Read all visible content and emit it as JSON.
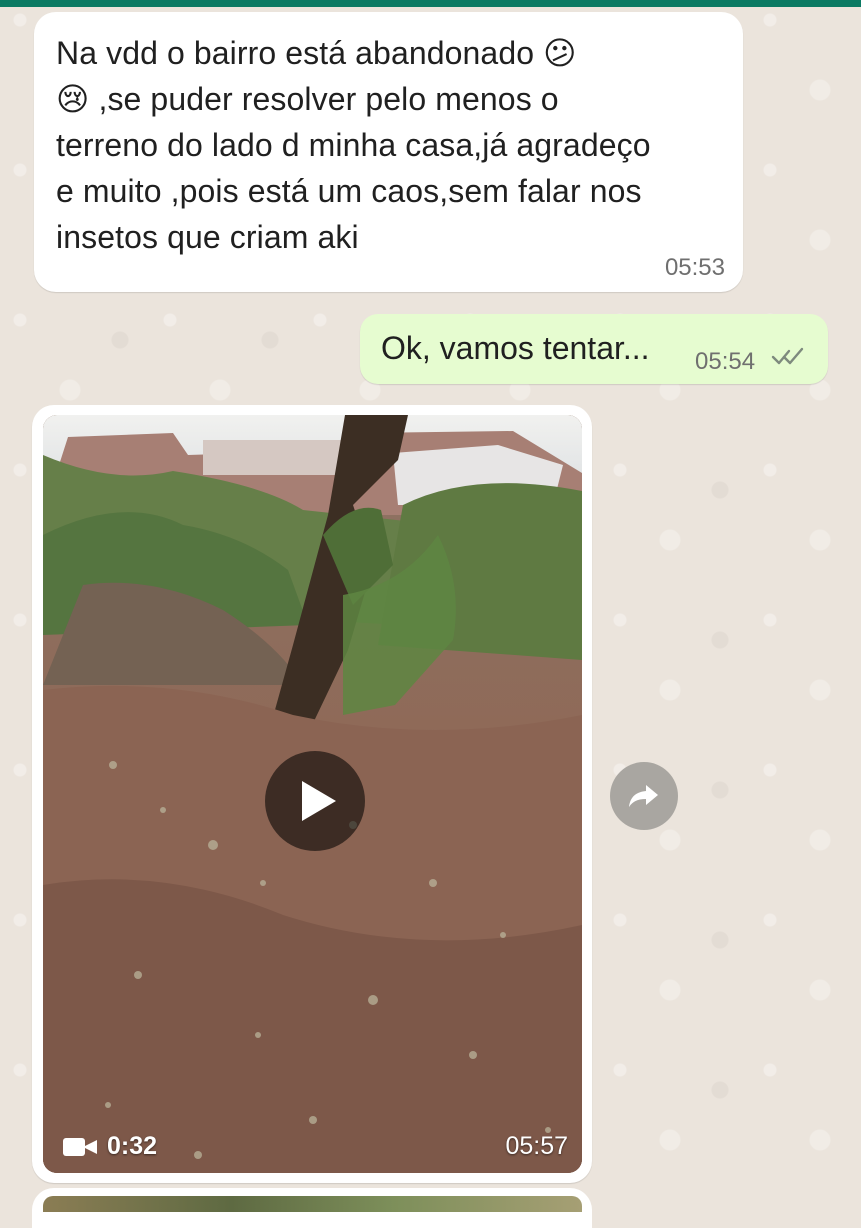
{
  "messages": [
    {
      "type": "text",
      "direction": "incoming",
      "text": "Na vdd o bairro está abandonado 😕\n😢 ,se puder resolver pelo menos o\nterreno do lado d minha casa,já agradeço\ne muito ,pois está um caos,sem falar nos\ninsetos que criam aki",
      "time": "05:53"
    },
    {
      "type": "text",
      "direction": "outgoing",
      "text": "Ok, vamos tentar...",
      "time": "05:54",
      "status_icon": "double-check-icon"
    },
    {
      "type": "video",
      "direction": "incoming",
      "duration": "0:32",
      "time": "05:57",
      "play_icon": "play-icon",
      "media_icon": "video-camera-icon"
    }
  ],
  "actions": {
    "forward_icon": "forward-icon"
  },
  "colors": {
    "incoming_bubble": "#ffffff",
    "outgoing_bubble": "#e6fcd0",
    "chat_background": "#ebe4dc",
    "accent_bar": "#0b7a63",
    "timestamp": "#6f6f6f"
  }
}
